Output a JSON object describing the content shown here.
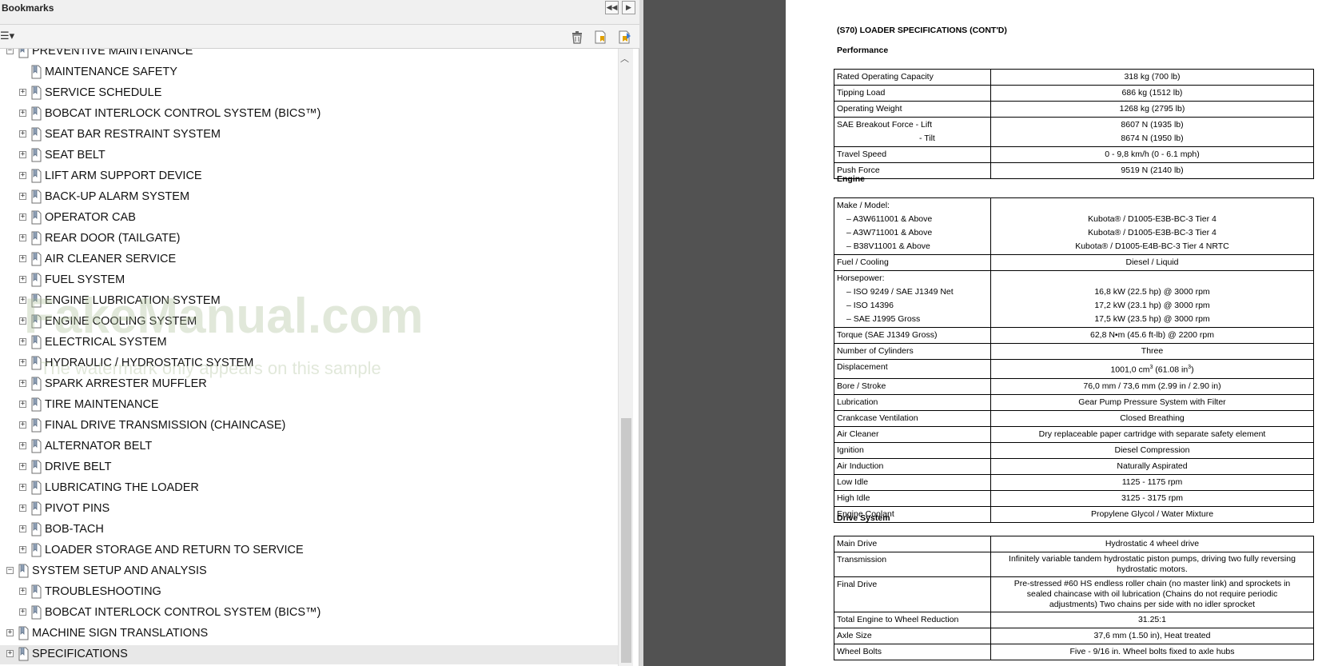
{
  "panel": {
    "title": "Bookmarks",
    "options_glyph": "☰▾"
  },
  "bookmarks": [
    {
      "label": "PREVENTIVE MAINTENANCE",
      "level": 0,
      "expander": "−"
    },
    {
      "label": "MAINTENANCE SAFETY",
      "level": 1,
      "expander": ""
    },
    {
      "label": "SERVICE SCHEDULE",
      "level": 1,
      "expander": "+"
    },
    {
      "label": "BOBCAT INTERLOCK CONTROL SYSTEM (BICS™)",
      "level": 1,
      "expander": "+"
    },
    {
      "label": "SEAT BAR RESTRAINT SYSTEM",
      "level": 1,
      "expander": "+"
    },
    {
      "label": "SEAT BELT",
      "level": 1,
      "expander": "+"
    },
    {
      "label": "LIFT ARM SUPPORT DEVICE",
      "level": 1,
      "expander": "+"
    },
    {
      "label": "BACK-UP ALARM SYSTEM",
      "level": 1,
      "expander": "+"
    },
    {
      "label": "OPERATOR CAB",
      "level": 1,
      "expander": "+"
    },
    {
      "label": "REAR DOOR (TAILGATE)",
      "level": 1,
      "expander": "+"
    },
    {
      "label": "AIR CLEANER SERVICE",
      "level": 1,
      "expander": "+"
    },
    {
      "label": "FUEL SYSTEM",
      "level": 1,
      "expander": "+"
    },
    {
      "label": "ENGINE LUBRICATION SYSTEM",
      "level": 1,
      "expander": "+"
    },
    {
      "label": "ENGINE COOLING SYSTEM",
      "level": 1,
      "expander": "+"
    },
    {
      "label": "ELECTRICAL SYSTEM",
      "level": 1,
      "expander": "+"
    },
    {
      "label": "HYDRAULIC / HYDROSTATIC SYSTEM",
      "level": 1,
      "expander": "+"
    },
    {
      "label": "SPARK ARRESTER MUFFLER",
      "level": 1,
      "expander": "+"
    },
    {
      "label": "TIRE MAINTENANCE",
      "level": 1,
      "expander": "+"
    },
    {
      "label": "FINAL DRIVE TRANSMISSION (CHAINCASE)",
      "level": 1,
      "expander": "+"
    },
    {
      "label": "ALTERNATOR BELT",
      "level": 1,
      "expander": "+"
    },
    {
      "label": "DRIVE BELT",
      "level": 1,
      "expander": "+"
    },
    {
      "label": "LUBRICATING THE LOADER",
      "level": 1,
      "expander": "+"
    },
    {
      "label": "PIVOT PINS",
      "level": 1,
      "expander": "+"
    },
    {
      "label": "BOB-TACH",
      "level": 1,
      "expander": "+"
    },
    {
      "label": "LOADER STORAGE AND RETURN TO SERVICE",
      "level": 1,
      "expander": "+"
    },
    {
      "label": "SYSTEM SETUP AND ANALYSIS",
      "level": 0,
      "expander": "−"
    },
    {
      "label": "TROUBLESHOOTING",
      "level": 1,
      "expander": "+"
    },
    {
      "label": "BOBCAT INTERLOCK CONTROL SYSTEM (BICS™)",
      "level": 1,
      "expander": "+"
    },
    {
      "label": "MACHINE SIGN TRANSLATIONS",
      "level": 0,
      "expander": "+"
    },
    {
      "label": "SPECIFICATIONS",
      "level": 0,
      "expander": "+",
      "selected": true
    }
  ],
  "watermark": {
    "main": "FakeManual.com",
    "sub": "The watermark only appears on this sample"
  },
  "doc": {
    "title": "(S70) LOADER SPECIFICATIONS (CONT'D)",
    "performance_heading": "Performance",
    "performance": [
      [
        "Rated Operating Capacity",
        "318 kg (700 lb)"
      ],
      [
        "Tipping Load",
        "686 kg (1512 lb)"
      ],
      [
        "Operating Weight",
        "1268 kg (2795 lb)"
      ]
    ],
    "breakout": {
      "label1": "SAE Breakout Force - Lift",
      "label2": "- Tilt",
      "val1": "8607 N (1935 lb)",
      "val2": "8674 N (1950 lb)"
    },
    "performance2": [
      [
        "Travel Speed",
        "0 - 9,8 km/h (0 - 6.1 mph)"
      ],
      [
        "Push Force",
        "9519 N (2140 lb)"
      ]
    ],
    "engine_heading": "Engine",
    "make": {
      "label": "Make / Model:",
      "items": [
        [
          "– A3W611001 & Above",
          "Kubota® / D1005-E3B-BC-3 Tier 4"
        ],
        [
          "– A3W711001 & Above",
          "Kubota® / D1005-E3B-BC-3 Tier 4"
        ],
        [
          "– B38V11001 & Above",
          "Kubota® / D1005-E4B-BC-3 Tier 4 NRTC"
        ]
      ]
    },
    "fuel": [
      "Fuel / Cooling",
      "Diesel / Liquid"
    ],
    "horsepower": {
      "label": "Horsepower:",
      "items": [
        [
          "– ISO 9249 / SAE J1349 Net",
          "16,8 kW (22.5 hp) @ 3000 rpm"
        ],
        [
          "– ISO 14396",
          "17,2 kW (23.1 hp) @ 3000 rpm"
        ],
        [
          "– SAE J1995 Gross",
          "17,5 kW (23.5 hp) @ 3000 rpm"
        ]
      ]
    },
    "engine_rows": [
      [
        "Torque (SAE J1349 Gross)",
        "62,8 N•m (45.6 ft-lb) @ 2200 rpm"
      ],
      [
        "Number of Cylinders",
        "Three"
      ]
    ],
    "displacement": {
      "label": "Displacement",
      "val_a": "1001,0 cm",
      "sup1": "3",
      "val_b": " (61.08 in",
      "sup2": "3",
      "val_c": ")"
    },
    "engine_rows2": [
      [
        "Bore / Stroke",
        "76,0 mm / 73,6 mm (2.99 in / 2.90 in)"
      ],
      [
        "Lubrication",
        "Gear Pump Pressure System with Filter"
      ],
      [
        "Crankcase Ventilation",
        "Closed Breathing"
      ],
      [
        "Air Cleaner",
        "Dry replaceable paper cartridge with separate safety element"
      ],
      [
        "Ignition",
        "Diesel Compression"
      ],
      [
        "Air Induction",
        "Naturally Aspirated"
      ],
      [
        "Low Idle",
        "1125 - 1175 rpm"
      ],
      [
        "High Idle",
        "3125 - 3175 rpm"
      ],
      [
        "Engine Coolant",
        "Propylene Glycol / Water Mixture"
      ]
    ],
    "drive_heading": "Drive System",
    "drive": {
      "main": [
        "Main Drive",
        "Hydrostatic 4 wheel drive"
      ],
      "trans_label": "Transmission",
      "trans_1": "Infinitely variable tandem hydrostatic piston pumps, driving two fully reversing",
      "trans_2": "hydrostatic motors.",
      "final_label": "Final Drive",
      "final_1": "Pre-stressed #60 HS endless roller chain (no master link) and sprockets in",
      "final_2": "sealed chaincase with oil lubrication (Chains do not require periodic",
      "final_3": "adjustments) Two chains per side with no idler sprocket",
      "reduction": [
        "Total Engine to Wheel Reduction",
        "31.25:1"
      ],
      "axle": [
        "Axle Size",
        "37,6 mm (1.50 in), Heat treated"
      ],
      "bolts": [
        "Wheel Bolts",
        "Five - 9/16 in. Wheel bolts fixed to axle hubs"
      ]
    }
  }
}
